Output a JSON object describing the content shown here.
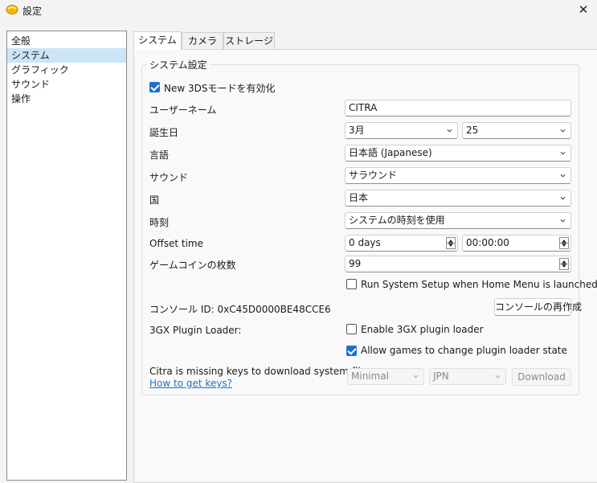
{
  "window": {
    "title": "設定",
    "icon": "citra-app-icon",
    "close_glyph": "✕"
  },
  "sidebar": {
    "items": [
      {
        "label": "全般",
        "selected": false
      },
      {
        "label": "システム",
        "selected": true
      },
      {
        "label": "グラフィック",
        "selected": false
      },
      {
        "label": "サウンド",
        "selected": false
      },
      {
        "label": "操作",
        "selected": false
      }
    ]
  },
  "tabs": [
    {
      "label": "システム"
    },
    {
      "label": "カメラ"
    },
    {
      "label": "ストレージ"
    }
  ],
  "group": {
    "title": "システム設定",
    "new3ds": {
      "label": "New 3DSモードを有効化",
      "checked": true
    },
    "username": {
      "label": "ユーザーネーム",
      "value": "CITRA"
    },
    "birthday": {
      "label": "誕生日",
      "month": "3月",
      "day": "25"
    },
    "language": {
      "label": "言語",
      "value": "日本語 (Japanese)"
    },
    "sound": {
      "label": "サウンド",
      "value": "サラウンド"
    },
    "country": {
      "label": "国",
      "value": "日本"
    },
    "clock": {
      "label": "時刻",
      "value": "システムの時刻を使用"
    },
    "offset": {
      "label": "Offset time",
      "days": "0 days",
      "time": "00:00:00"
    },
    "coins": {
      "label": "ゲームコインの枚数",
      "value": "99"
    },
    "run_setup": {
      "label": "Run System Setup when Home Menu is launched",
      "checked": false
    },
    "console_id": {
      "label": "コンソール ID: 0xC45D0000BE48CCE6",
      "button": "コンソールの再作成"
    },
    "plugin": {
      "label": "3GX Plugin Loader:",
      "enable": {
        "label": "Enable 3GX plugin loader",
        "checked": false
      },
      "allow": {
        "label": "Allow games to change plugin loader state",
        "checked": true
      }
    },
    "keys": {
      "message": "Citra is missing keys to download system files.",
      "link": "How to get keys?",
      "mode": "Minimal",
      "region": "JPN",
      "download": "Download"
    }
  },
  "colors": {
    "accent": "#1e6fd0",
    "selection": "#cce4f7",
    "link": "#1a73c8"
  }
}
